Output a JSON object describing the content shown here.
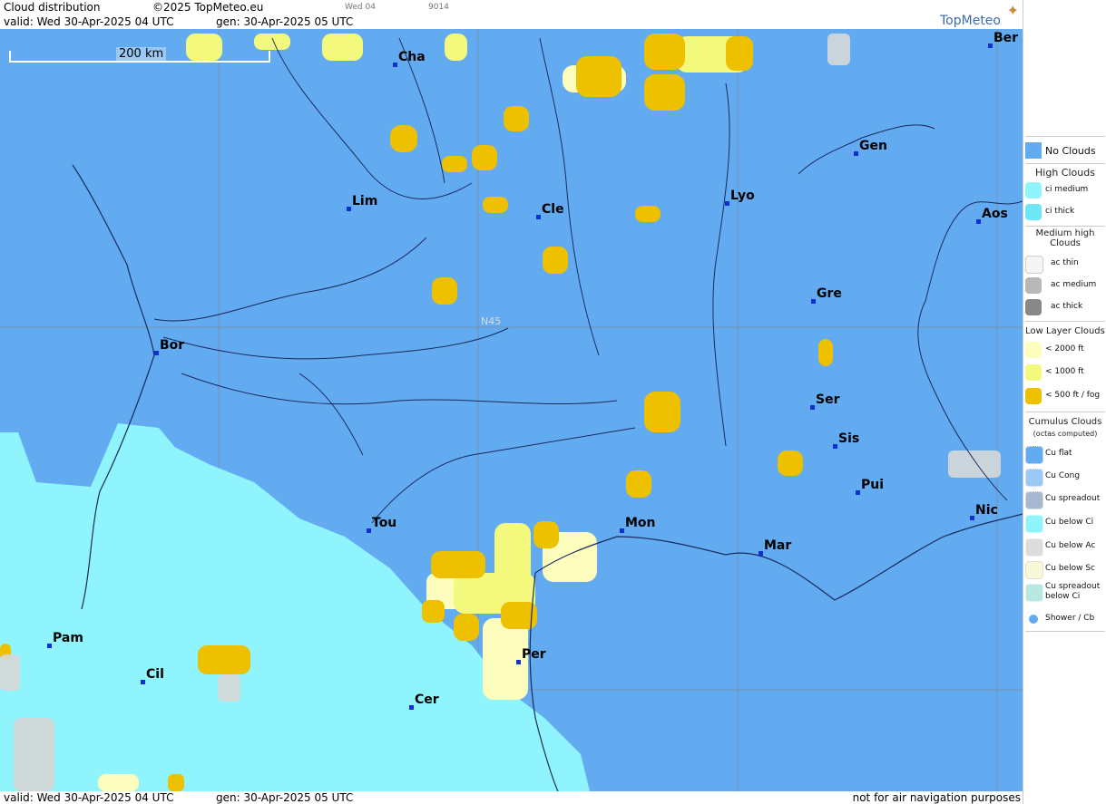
{
  "header": {
    "title": "Cloud distribution",
    "copyright": "©2025 TopMeteo.eu",
    "day_code": "Wed 04",
    "code": "9014",
    "valid": "valid:  Wed  30-Apr-2025  04 UTC",
    "gen": "gen:  30-Apr-2025 05 UTC",
    "logo": "TopMeteo"
  },
  "footer": {
    "valid": "valid:  Wed  30-Apr-2025  04 UTC",
    "gen": "gen: 30-Apr-2025 05 UTC",
    "disclaimer": "not for air navigation purposes"
  },
  "map": {
    "scale_label": "200 km",
    "latitude_label": "N45",
    "cities": [
      "Cha",
      "Ber",
      "Gen",
      "Lim",
      "Cle",
      "Lyo",
      "Aos",
      "Gre",
      "Bor",
      "Ser",
      "Sis",
      "Pui",
      "Nic",
      "Tou",
      "Mon",
      "Mar",
      "Pam",
      "Cil",
      "Per",
      "Cer"
    ]
  },
  "legend": {
    "no_clouds": "No Clouds",
    "high_title": "High Clouds",
    "ci_medium": "ci medium",
    "ci_thick": "ci thick",
    "medium_title": "Medium high Clouds",
    "ac_thin": "ac thin",
    "ac_medium": "ac medium",
    "ac_thick": "ac thick",
    "low_title": "Low Layer Clouds",
    "low_2000": "< 2000 ft",
    "low_1000": "< 1000 ft",
    "low_500": "< 500 ft / fog",
    "cu_title": "Cumulus Clouds",
    "cu_sub": "(octas computed)",
    "cu_flat": "Cu flat",
    "cu_cong": "Cu Cong",
    "cu_spread": "Cu spreadout",
    "cu_below_ci": "Cu below Ci",
    "cu_below_ac": "Cu below Ac",
    "cu_below_sc": "Cu below Sc",
    "cu_spread_ci": "Cu spreadout below Ci",
    "shower": "Shower / Cb"
  },
  "colors": {
    "no_clouds": "#62abf0",
    "ci": "#8ff4fb",
    "low_2000": "#fdfdbd",
    "low_1000": "#f3f97c",
    "low_500": "#edc000"
  }
}
